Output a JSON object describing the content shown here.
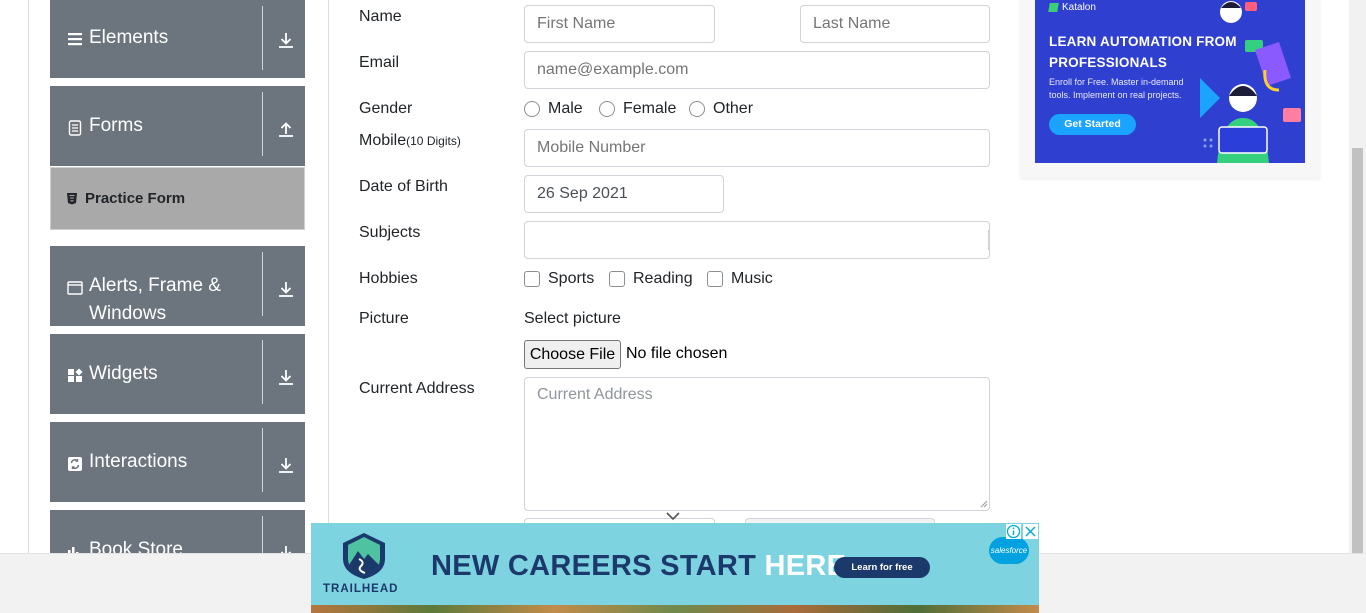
{
  "sidebar": {
    "groups": [
      {
        "label": "Elements",
        "icon": "hamburger-icon",
        "toggle": "download-icon"
      },
      {
        "label": "Forms",
        "icon": "document-icon",
        "toggle": "upload-icon"
      },
      {
        "label": "Alerts, Frame & Windows",
        "icon": "window-icon",
        "toggle": "download-icon"
      },
      {
        "label": "Widgets",
        "icon": "widgets-icon",
        "toggle": "download-icon"
      },
      {
        "label": "Interactions",
        "icon": "interactions-icon",
        "toggle": "download-icon"
      },
      {
        "label": "Book Store",
        "icon": "bar-chart-icon",
        "toggle": "download-icon"
      }
    ],
    "active_item": {
      "label": "Practice Form",
      "icon": "html5-icon"
    }
  },
  "form": {
    "name_label": "Name",
    "first_name_placeholder": "First Name",
    "last_name_placeholder": "Last Name",
    "email_label": "Email",
    "email_placeholder": "name@example.com",
    "gender_label": "Gender",
    "gender_options": [
      "Male",
      "Female",
      "Other"
    ],
    "mobile_label": "Mobile",
    "mobile_hint": "(10 Digits)",
    "mobile_placeholder": "Mobile Number",
    "dob_label": "Date of Birth",
    "dob_value": "26 Sep 2021",
    "subjects_label": "Subjects",
    "hobbies_label": "Hobbies",
    "hobbies_options": [
      "Sports",
      "Reading",
      "Music"
    ],
    "picture_label": "Picture",
    "select_picture": "Select picture",
    "choose_file": "Choose File",
    "no_file": "No file chosen",
    "address_label": "Current Address",
    "address_placeholder": "Current Address"
  },
  "ad_right": {
    "brand": "Katalon",
    "headline": "LEARN AUTOMATION FROM PROFESSIONALS",
    "sub": "Enroll for Free. Master in-demand tools. Implement on real projects.",
    "cta": "Get Started"
  },
  "ad_bottom": {
    "logo": "TRAILHEAD",
    "headline_a": "NEW CAREERS START ",
    "headline_b": "HERE.",
    "cta": "Learn for free",
    "partner": "salesforce"
  },
  "colors": {
    "sidebar_bg": "#6c757d",
    "active_bg": "#a9a9a9",
    "ad_right_bg": "#2f3fd0",
    "ad_bottom_bg": "#7ed3e0",
    "ad_bottom_text": "#1b3a6b"
  }
}
